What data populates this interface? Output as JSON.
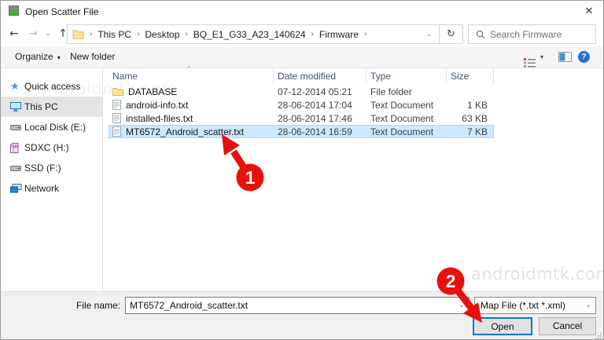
{
  "window": {
    "title": "Open Scatter File"
  },
  "icons": {
    "back": "←",
    "forward": "→",
    "up": "↑",
    "refresh": "↻",
    "caret_down": "▾",
    "chevron_down": "⌄",
    "crumb_sep": "›",
    "close": "✕",
    "help": "?",
    "sort_asc": "˄"
  },
  "navigation": {
    "breadcrumbs": [
      "This PC",
      "Desktop",
      "BQ_E1_G33_A23_140624",
      "Firmware"
    ],
    "search_placeholder": "Search Firmware"
  },
  "toolbar": {
    "organize": "Organize",
    "new_folder": "New folder"
  },
  "sidebar": {
    "items": [
      {
        "label": "Quick access",
        "icon": "star"
      },
      {
        "label": "This PC",
        "icon": "monitor",
        "selected": true
      },
      {
        "label": "Local Disk (E:)",
        "icon": "drive"
      },
      {
        "label": "SDXC (H:)",
        "icon": "sd-card"
      },
      {
        "label": "SSD (F:)",
        "icon": "drive"
      },
      {
        "label": "Network",
        "icon": "network"
      }
    ]
  },
  "file_list": {
    "columns": {
      "name": "Name",
      "date": "Date modified",
      "type": "Type",
      "size": "Size"
    },
    "rows": [
      {
        "icon": "folder",
        "name": "DATABASE",
        "date": "07-12-2014 05:21",
        "type": "File folder",
        "size": ""
      },
      {
        "icon": "text-file",
        "name": "android-info.txt",
        "date": "28-06-2014 17:04",
        "type": "Text Document",
        "size": "1 KB"
      },
      {
        "icon": "text-file",
        "name": "installed-files.txt",
        "date": "28-06-2014 17:46",
        "type": "Text Document",
        "size": "63 KB"
      },
      {
        "icon": "text-file",
        "name": "MT6572_Android_scatter.txt",
        "date": "28-06-2014 16:59",
        "type": "Text Document",
        "size": "7 KB",
        "selected": true
      }
    ]
  },
  "footer": {
    "file_name_label": "File name:",
    "file_name_value": "MT6572_Android_scatter.txt",
    "file_type_value": "Map File (*.txt *.xml)",
    "open_label": "Open",
    "cancel_label": "Cancel"
  },
  "watermark": {
    "text": "androidmtk.com"
  },
  "annotations": {
    "color": "#e8100c",
    "step1": "1",
    "step2": "2"
  }
}
